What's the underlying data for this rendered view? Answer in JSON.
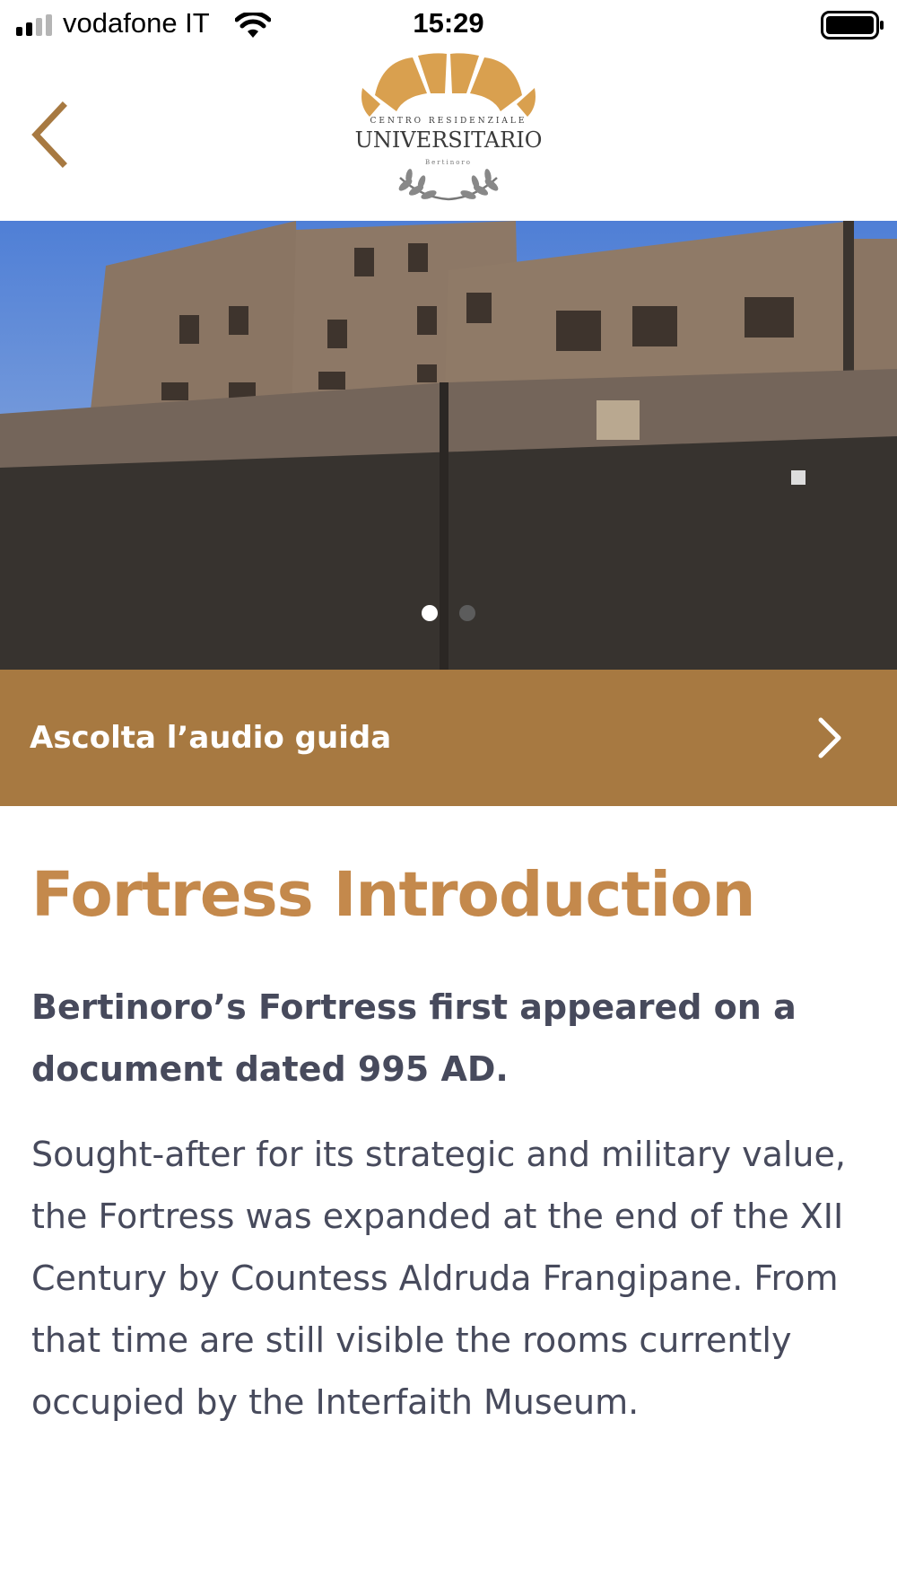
{
  "status_bar": {
    "carrier": "vodafone IT",
    "time": "15:29",
    "signal_bars": 2,
    "signal_bars_total": 4,
    "icons": [
      "signal-icon",
      "wifi-icon",
      "battery-icon"
    ]
  },
  "nav": {
    "back_icon": "chevron-left-icon",
    "logo": {
      "top_text": "CENTRO RESIDENZIALE",
      "main_text": "UNIVERSITARIO",
      "sub_text": "Bertinoro"
    }
  },
  "hero": {
    "slide_count": 2,
    "active_slide": 1
  },
  "audio_guide": {
    "label": "Ascolta l’audio guida",
    "icon": "chevron-right-icon"
  },
  "article": {
    "title": "Fortress Introduction",
    "lead": "Bertinoro’s Fortress first appeared on a document dated 995 AD.",
    "body": "Sought-after for its strategic and military value, the Fortress was expanded at the end of the XII Century by Countess Aldruda Frangipane. From that time are still visible the rooms currently occupied by the Interfaith Museum."
  },
  "colors": {
    "accent": "#a77941",
    "title": "#c4894c",
    "text": "#474a5c",
    "logo_gold": "#d9a04f"
  }
}
